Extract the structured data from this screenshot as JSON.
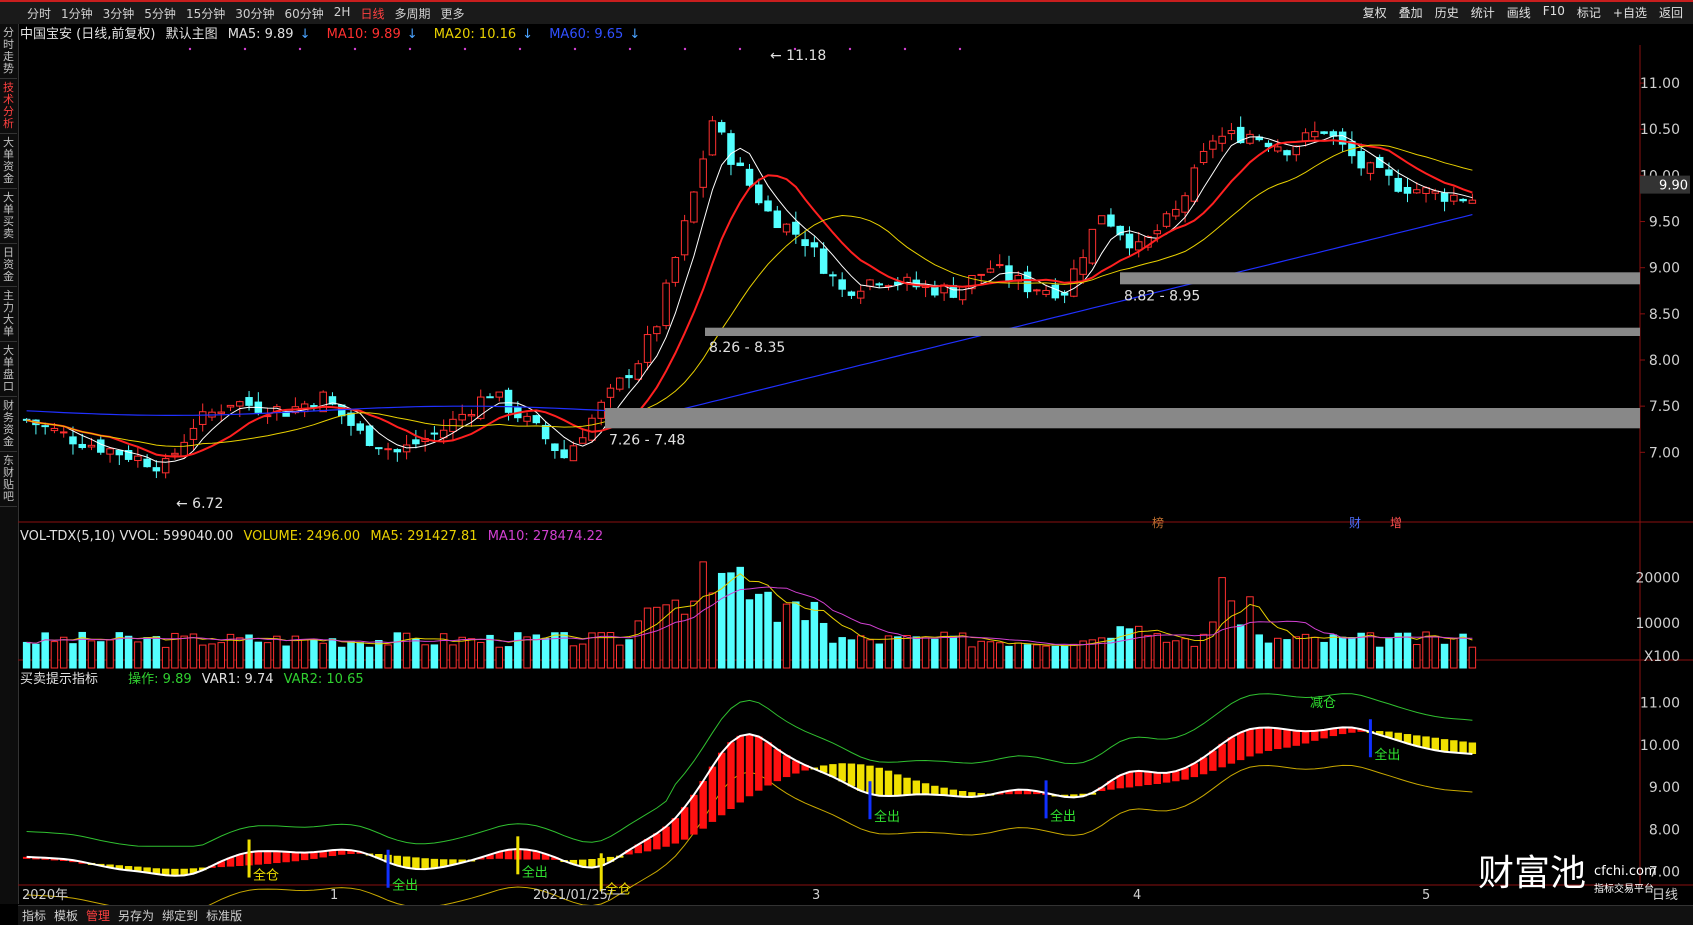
{
  "toolbar": {
    "periods": [
      "分时",
      "1分钟",
      "3分钟",
      "5分钟",
      "15分钟",
      "30分钟",
      "60分钟",
      "2H",
      "日线",
      "多周期",
      "更多"
    ],
    "active": "日线",
    "right": [
      "复权",
      "叠加",
      "历史",
      "统计",
      "画线",
      "F10",
      "标记",
      "+自选",
      "返回"
    ]
  },
  "leftnav": [
    "分时走势",
    "技术分析",
    "大单资金",
    "大单买卖",
    "日资金",
    "主力大单",
    "大单盘口",
    "财务资金",
    "东财贴吧"
  ],
  "main": {
    "title": "中国宝安 (日线,前复权)",
    "subtitle": "默认主图",
    "ma5": "MA5: 9.89",
    "ma10": "MA10: 9.89",
    "ma20": "MA20: 10.16",
    "ma60": "MA60: 9.65",
    "price_ticks": [
      "11.00",
      "10.50",
      "10.00",
      "9.50",
      "9.00",
      "8.50",
      "8.00",
      "7.50",
      "7.00"
    ],
    "current_price": "9.90",
    "high_label": "11.18",
    "low_label": "6.72",
    "zones": [
      "8.82 - 8.95",
      "8.26 - 8.35",
      "7.26 - 7.48"
    ],
    "markers": [
      "榜",
      "财",
      "增"
    ]
  },
  "volume": {
    "title": "VOL-TDX(5,10) VVOL: 599040.00",
    "volume": "VOLUME: 2496.00",
    "ma5": "MA5: 291427.81",
    "ma10": "MA10: 278474.22",
    "ticks": [
      "20000",
      "10000",
      "X100"
    ]
  },
  "indicator": {
    "title": "买卖提示指标",
    "op": "操作: 9.89",
    "var1": "VAR1: 9.74",
    "var2": "VAR2: 10.65",
    "ticks": [
      "11.00",
      "10.00",
      "9.00",
      "8.00",
      "7.00"
    ],
    "labels": {
      "full": "全仓",
      "out": "全出",
      "reduce": "减仓"
    }
  },
  "xaxis": {
    "labels": [
      "2020年",
      "1",
      "2021/01/25/一",
      "3",
      "4",
      "5"
    ],
    "period": "日线"
  },
  "bottom": [
    "指标",
    "模板",
    "管理",
    "另存为",
    "绑定到",
    "标准版"
  ],
  "bottom_active": "管理",
  "watermark": {
    "main": "财富池",
    "site": "cfchi.com",
    "tag": "指标交易平台"
  },
  "chart_data": {
    "type": "candlestick",
    "title": "中国宝安 (日线,前复权)",
    "ylim": [
      6.6,
      11.3
    ],
    "annotations": [
      "11.18",
      "6.72",
      "8.82 - 8.95",
      "8.26 - 8.35",
      "7.26 - 7.48"
    ],
    "current": 9.9,
    "ma": {
      "MA5": 9.89,
      "MA10": 9.89,
      "MA20": 10.16,
      "MA60": 9.65
    }
  }
}
